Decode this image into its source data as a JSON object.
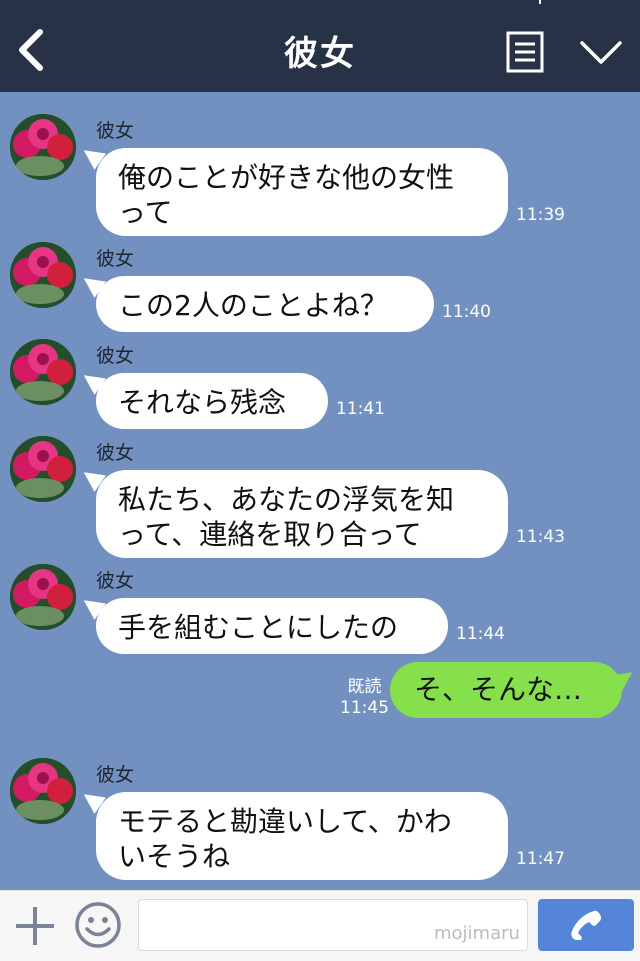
{
  "header": {
    "title": "彼女"
  },
  "messages": [
    {
      "sender": "彼女",
      "lines": [
        "俺のことが好きな他の女性",
        "って"
      ],
      "time": "11:39"
    },
    {
      "sender": "彼女",
      "lines": [
        "この2人のことよね？"
      ],
      "time": "11:40"
    },
    {
      "sender": "彼女",
      "lines": [
        "それなら残念"
      ],
      "time": "11:41"
    },
    {
      "sender": "彼女",
      "lines": [
        "私たち、あなたの浮気を知",
        "って、連絡を取り合って"
      ],
      "time": "11:43"
    },
    {
      "sender": "彼女",
      "lines": [
        "手を組むことにしたの"
      ],
      "time": "11:44"
    },
    {
      "sender": "彼女",
      "lines": [
        "モテると勘違いして、かわ",
        "いそうね"
      ],
      "time": "11:47"
    }
  ],
  "sent": {
    "text": "そ、そんな…",
    "read_label": "既読",
    "time": "11:45"
  },
  "footer": {
    "watermark": "mojimaru"
  },
  "colors": {
    "header": "#273246",
    "background": "#7291c1",
    "sent_bubble": "#85e04b",
    "call_button": "#5585d8"
  },
  "icons": {
    "back": "chevron-left-icon",
    "notes": "notes-icon",
    "menu": "chevron-down-icon",
    "plus": "plus-icon",
    "sticker": "smile-icon",
    "call": "phone-icon"
  }
}
